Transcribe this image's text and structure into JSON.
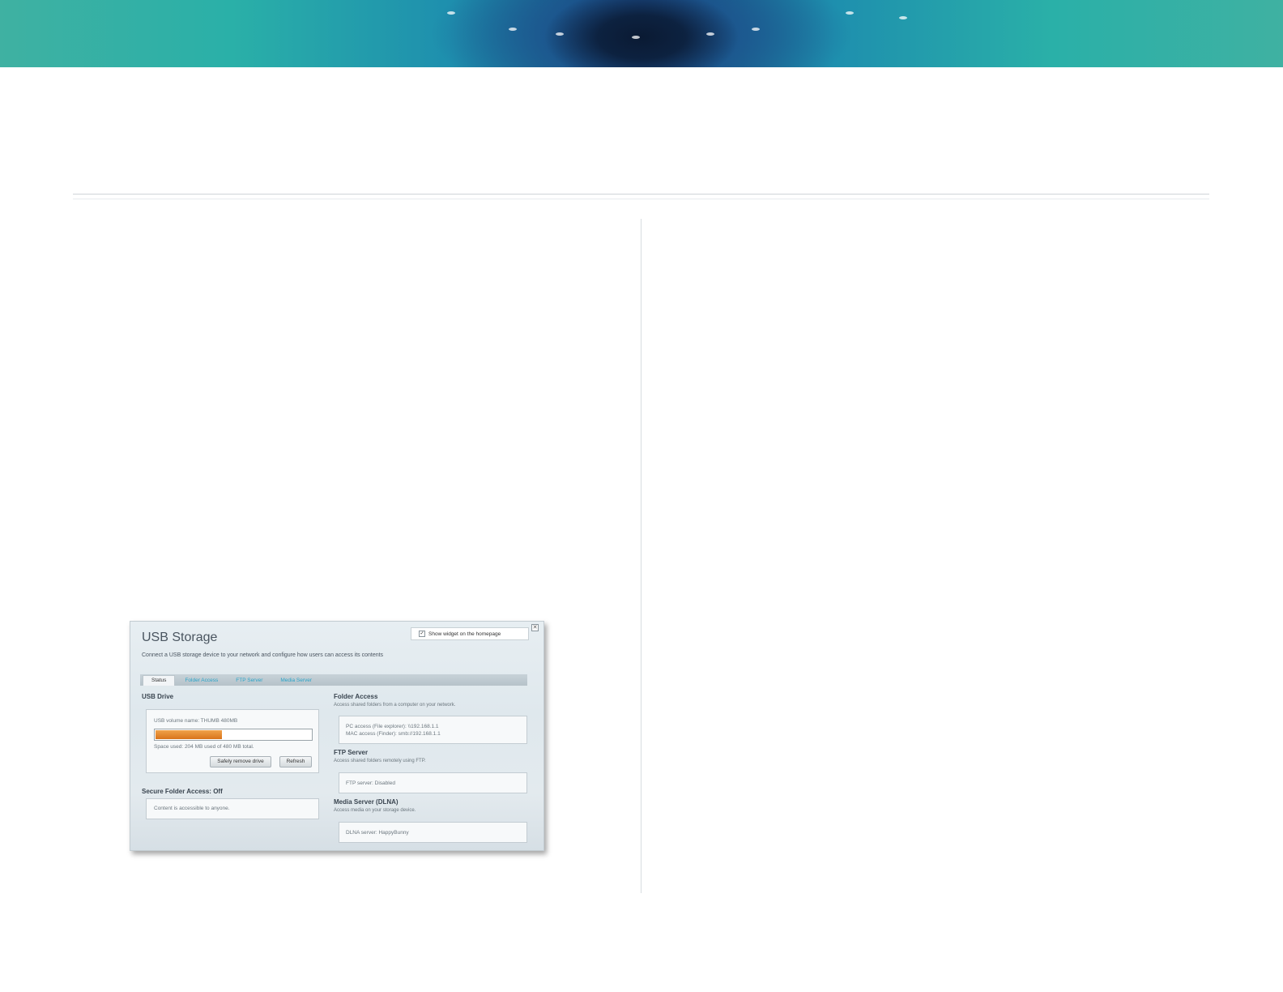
{
  "widget": {
    "title": "USB Storage",
    "subtitle": "Connect a USB storage device to your network and configure how users can access its contents",
    "show_widget_label": "Show widget on the homepage",
    "show_widget_checked": true,
    "tabs": [
      {
        "label": "Status",
        "active": true
      },
      {
        "label": "Folder Access",
        "active": false
      },
      {
        "label": "FTP Server",
        "active": false
      },
      {
        "label": "Media Server",
        "active": false
      }
    ],
    "usb_drive": {
      "heading": "USB Drive",
      "volume_name": "USB volume name: THUMB 480MB",
      "space_used": "Space used: 204 MB used of 480 MB total.",
      "usage_fraction": 0.425,
      "remove_button": "Safely remove drive",
      "refresh_button": "Refresh"
    },
    "secure_folder": {
      "heading": "Secure Folder Access: Off",
      "text": "Content is accessible to anyone."
    },
    "folder_access": {
      "heading": "Folder Access",
      "description": "Access shared folders from a computer on your network.",
      "pc_access": "PC access (File explorer): \\\\192.168.1.1",
      "mac_access": "MAC access (Finder): smb://192.168.1.1"
    },
    "ftp_server": {
      "heading": "FTP Server",
      "description": "Access shared folders remotely using FTP.",
      "status": "FTP server: Disabled"
    },
    "media_server": {
      "heading": "Media Server (DLNA)",
      "description": "Access media on your storage device.",
      "status": "DLNA server: HappyBunny"
    }
  },
  "colors": {
    "accent_tab": "#2aa4c8",
    "progress_fill": "#e08a2c",
    "banner_teal": "#2ab0a8",
    "banner_blue": "#16407a"
  }
}
